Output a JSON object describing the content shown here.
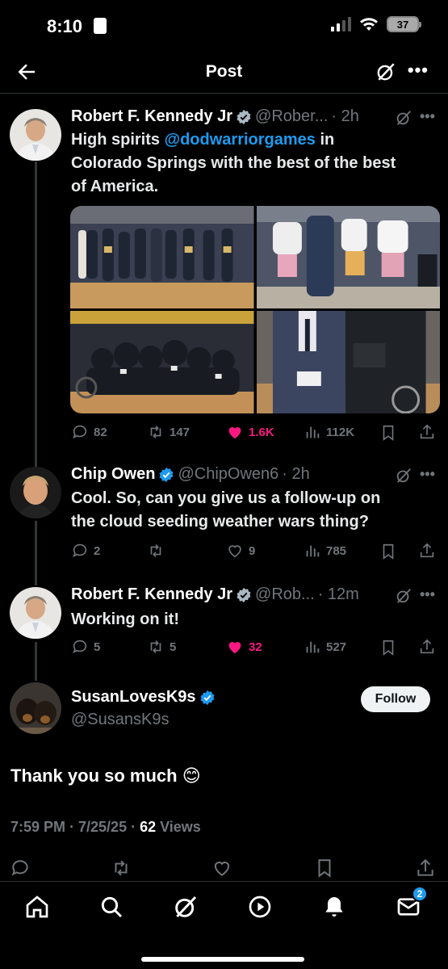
{
  "status": {
    "time": "8:10",
    "battery": "37"
  },
  "header": {
    "title": "Post"
  },
  "posts": [
    {
      "name": "Robert F. Kennedy Jr",
      "handle": "@Rober...",
      "time": "· 2h",
      "text_line1_pre": "High spirits ",
      "mention": "@dodwarriorgames",
      "text_line1_post": " in",
      "text_line2": "Colorado Springs with the best of the best",
      "text_line3": "of America.",
      "replies": "82",
      "reposts": "147",
      "likes": "1.6K",
      "views": "112K"
    },
    {
      "name": "Chip Owen",
      "handle": "@ChipOwen6",
      "time": "· 2h",
      "text_line1": "Cool. So, can you give us a follow-up on",
      "text_line2": "the cloud seeding weather wars thing?",
      "replies": "2",
      "reposts": "",
      "likes": "9",
      "views": "785"
    },
    {
      "name": "Robert F. Kennedy Jr",
      "handle": "@Rob...",
      "time": "· 12m",
      "text_line1": "Working on it!",
      "replies": "5",
      "reposts": "5",
      "likes": "32",
      "views": "527"
    }
  ],
  "focus": {
    "name": "SusanLovesK9s",
    "handle": "@SusansK9s",
    "follow_label": "Follow",
    "text": "Thank you so much 😊",
    "meta_time": "7:59 PM · 7/25/25 · ",
    "views_count": "62",
    "views_label": " Views"
  },
  "tabbar": {
    "messages_badge": "2"
  },
  "colors": {
    "accent": "#1d9bf0",
    "like": "#f91880",
    "muted": "#71767b"
  }
}
